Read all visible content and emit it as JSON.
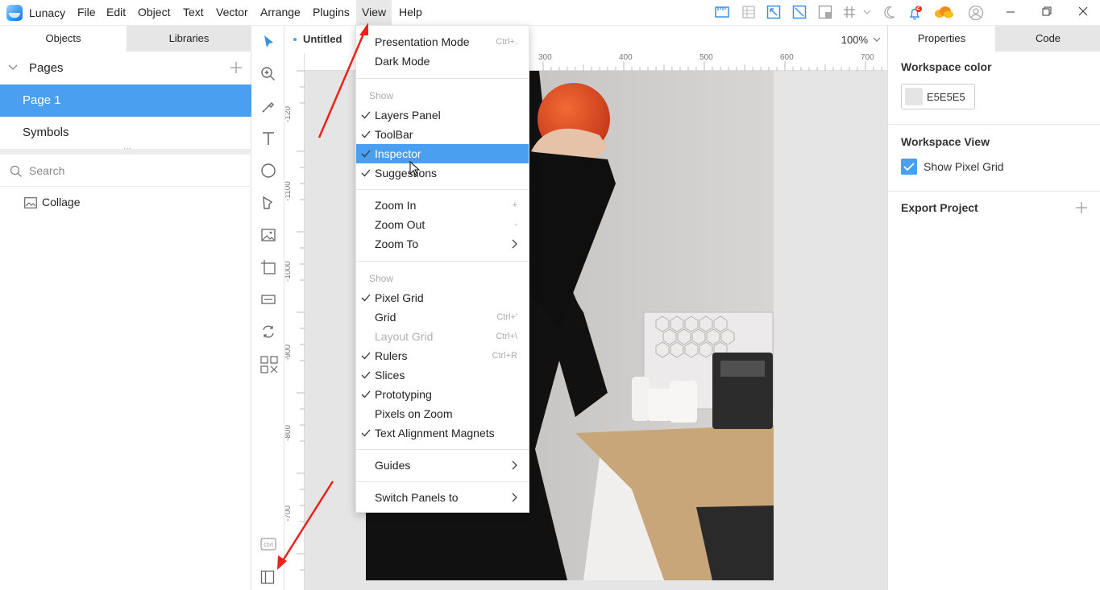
{
  "app": {
    "name": "Lunacy",
    "menu": [
      "File",
      "Edit",
      "Object",
      "Text",
      "Vector",
      "Arrange",
      "Plugins",
      "View",
      "Help"
    ],
    "active_menu": "View",
    "notification_count": "2"
  },
  "left_panel": {
    "tabs": {
      "objects": "Objects",
      "libraries": "Libraries"
    },
    "pages_title": "Pages",
    "pages": [
      "Page 1",
      "Symbols"
    ],
    "search_placeholder": "Search",
    "layers": [
      "Collage"
    ]
  },
  "canvas": {
    "document_title": "Untitled",
    "zoom": "100%",
    "h_ruler_labels": [
      "300",
      "400",
      "500",
      "600",
      "700"
    ],
    "v_ruler_labels": [
      "-120",
      "-1100",
      "-1000",
      "-900",
      "-800",
      "-700"
    ]
  },
  "right_panel": {
    "tabs": {
      "properties": "Properties",
      "code": "Code"
    },
    "workspace_color_title": "Workspace color",
    "workspace_color_value": "E5E5E5",
    "workspace_view_title": "Workspace View",
    "show_pixel_grid_label": "Show Pixel Grid",
    "show_pixel_grid_checked": true,
    "export_title": "Export Project"
  },
  "view_menu": {
    "presentation_mode": {
      "label": "Presentation Mode",
      "shortcut": "Ctrl+."
    },
    "dark_mode": {
      "label": "Dark Mode"
    },
    "show_header_1": "Show",
    "layers_panel": {
      "label": "Layers Panel",
      "checked": true
    },
    "toolbar": {
      "label": "ToolBar",
      "checked": true
    },
    "inspector": {
      "label": "Inspector",
      "checked": true,
      "highlighted": true
    },
    "suggestions": {
      "label": "Suggestions",
      "checked": true
    },
    "zoom_in": {
      "label": "Zoom In",
      "shortcut": "+"
    },
    "zoom_out": {
      "label": "Zoom Out",
      "shortcut": "-"
    },
    "zoom_to": {
      "label": "Zoom To"
    },
    "show_header_2": "Show",
    "pixel_grid": {
      "label": "Pixel Grid",
      "checked": true
    },
    "grid": {
      "label": "Grid",
      "shortcut": "Ctrl+'"
    },
    "layout_grid": {
      "label": "Layout Grid",
      "shortcut": "Ctrl+\\",
      "disabled": true
    },
    "rulers": {
      "label": "Rulers",
      "shortcut": "Ctrl+R",
      "checked": true
    },
    "slices": {
      "label": "Slices",
      "checked": true
    },
    "prototyping": {
      "label": "Prototyping",
      "checked": true
    },
    "pixels_on_zoom": {
      "label": "Pixels on Zoom"
    },
    "text_alignment_magnets": {
      "label": "Text Alignment Magnets",
      "checked": true
    },
    "guides": {
      "label": "Guides"
    },
    "switch_panels_to": {
      "label": "Switch Panels to"
    }
  },
  "colors": {
    "accent": "#4a9ff0",
    "workspace": "#e5e5e5",
    "annotation_arrow": "#e8231a"
  }
}
